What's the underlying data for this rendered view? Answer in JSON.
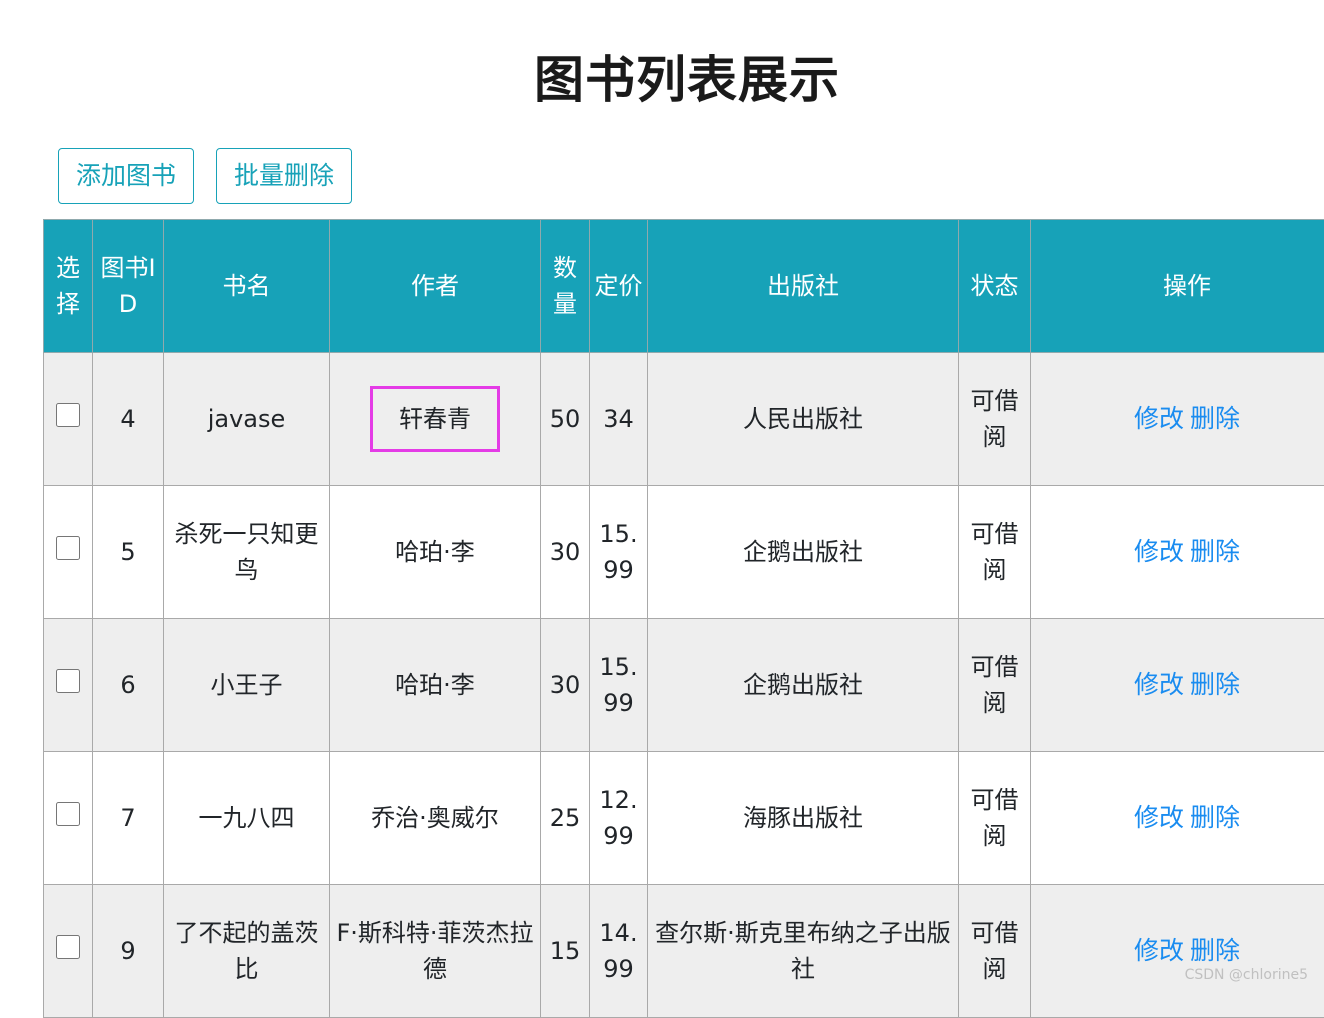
{
  "page": {
    "title": "图书列表展示"
  },
  "toolbar": {
    "add_label": "添加图书",
    "batch_delete_label": "批量删除"
  },
  "table": {
    "headers": {
      "select": "选择",
      "id": "图书ID",
      "name": "书名",
      "author": "作者",
      "count": "数量",
      "price": "定价",
      "publisher": "出版社",
      "status": "状态",
      "ops": "操作"
    },
    "edit_label": "修改",
    "delete_label": "删除",
    "rows": [
      {
        "id": "4",
        "name": "javase",
        "author": "轩春青",
        "count": "50",
        "price": "34",
        "publisher": "人民出版社",
        "status": "可借阅"
      },
      {
        "id": "5",
        "name": "杀死一只知更鸟",
        "author": "哈珀·李",
        "count": "30",
        "price": "15.99",
        "publisher": "企鹅出版社",
        "status": "可借阅"
      },
      {
        "id": "6",
        "name": "小王子",
        "author": "哈珀·李",
        "count": "30",
        "price": "15.99",
        "publisher": "企鹅出版社",
        "status": "可借阅"
      },
      {
        "id": "7",
        "name": "一九八四",
        "author": "乔治·奥威尔",
        "count": "25",
        "price": "12.99",
        "publisher": "海豚出版社",
        "status": "可借阅"
      },
      {
        "id": "9",
        "name": "了不起的盖茨比",
        "author": "F·斯科特·菲茨杰拉德",
        "count": "15",
        "price": "14.99",
        "publisher": "查尔斯·斯克里布纳之子出版社",
        "status": "可借阅"
      }
    ]
  },
  "highlight_color": "#e43be6",
  "accent_color": "#17a2b8",
  "link_color": "#1a8cf0",
  "watermark": "CSDN @chlorine5"
}
